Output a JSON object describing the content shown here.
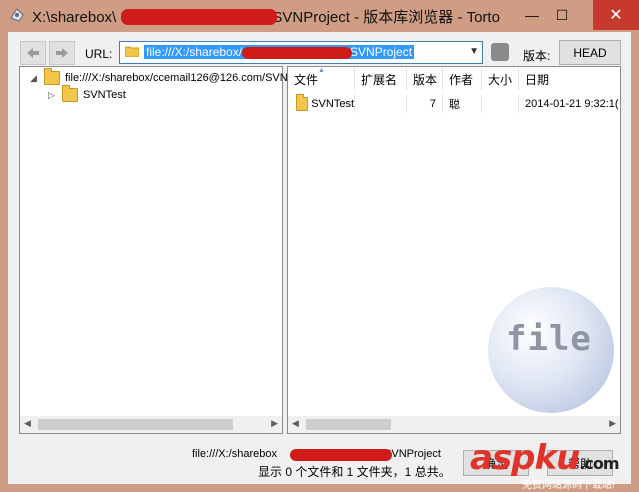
{
  "window": {
    "title_prefix": "X:\\sharebox\\",
    "title_suffix": "\\SVNProject - 版本库浏览器 - Torto",
    "minimize_glyph": "—",
    "maximize_glyph": "☐",
    "close_glyph": "✕"
  },
  "toolbar": {
    "back_icon": "back-arrow-icon",
    "forward_icon": "forward-arrow-icon",
    "url_label": "URL:",
    "url_value_prefix": "file:///X:/sharebox/",
    "url_value_suffix": "SVNProject",
    "revision_label": "版本:",
    "head_button": "HEAD"
  },
  "tree": {
    "root_label": "file:///X:/sharebox/ccemail126@126.com/SVN",
    "child_label": "SVNTest"
  },
  "list": {
    "columns": [
      "文件",
      "扩展名",
      "版本",
      "作者",
      "大小",
      "日期"
    ],
    "rows": [
      {
        "name": "SVNTest",
        "ext": "",
        "rev": "7",
        "author": "聪",
        "size": "",
        "date": "2014-01-21 9:32:1("
      }
    ],
    "watermark_text": "file"
  },
  "status": {
    "path_prefix": "file:///X:/sharebox",
    "path_suffix": "/SVNProject",
    "summary": "显示 0 个文件和 1 文件夹，1 总共。",
    "ok_button": "确定",
    "help_button": "帮助"
  },
  "site_watermark": {
    "main": "aspku",
    "tld": ".com",
    "sub": "免费网站源码下载站!"
  },
  "colors": {
    "frame": "#cf9d84",
    "client": "#f0f0f0",
    "selection": "#3399ff",
    "redaction": "#d11a1a",
    "folder": "#f2c64a"
  }
}
